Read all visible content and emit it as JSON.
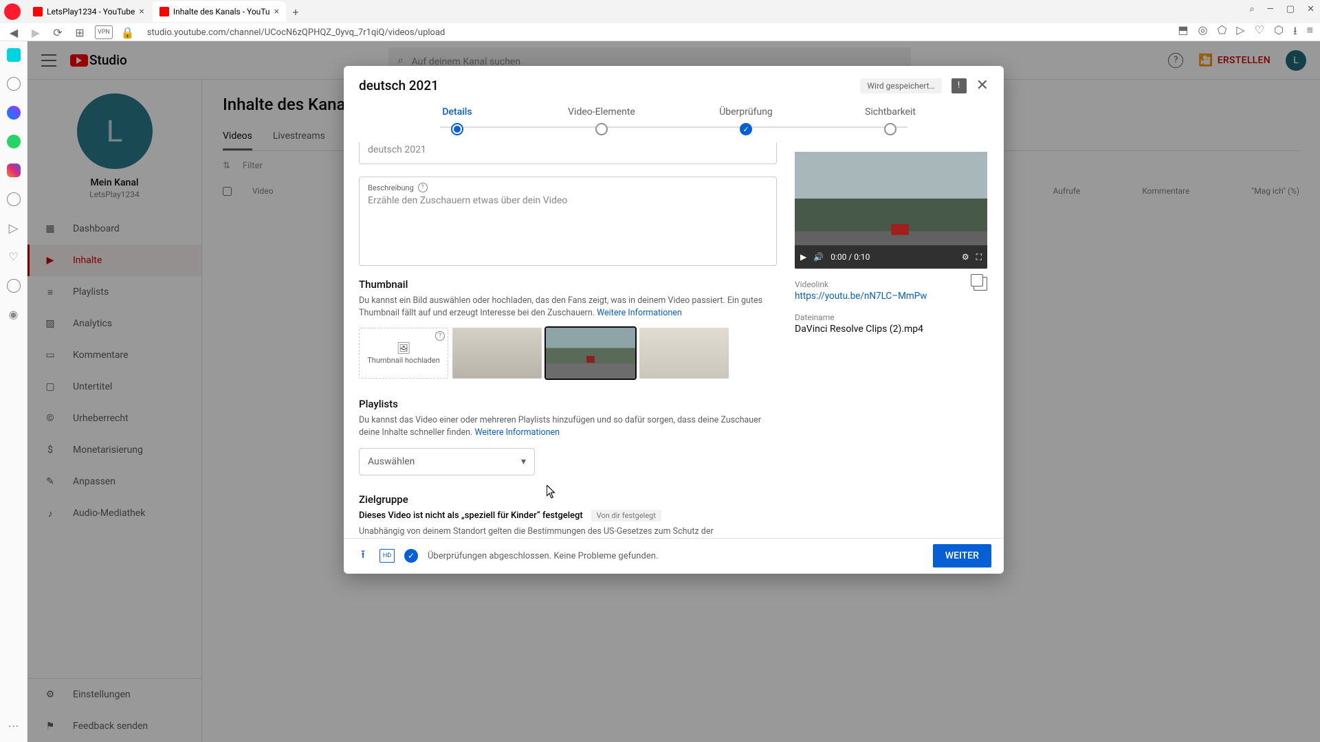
{
  "browser": {
    "tab1": "LetsPlay1234 - YouTube",
    "tab2": "Inhalte des Kanals - YouTu",
    "url": "studio.youtube.com/channel/UCocN6zQPHQZ_0yvq_7r1qiQ/videos/upload"
  },
  "header": {
    "logo_text": "Studio",
    "search_placeholder": "Auf deinem Kanal suchen",
    "create": "ERSTELLEN",
    "avatar": "L"
  },
  "channel": {
    "avatar_letter": "L",
    "name": "Mein Kanal",
    "handle": "LetsPlay1234"
  },
  "sidebar": {
    "dashboard": "Dashboard",
    "content": "Inhalte",
    "playlists": "Playlists",
    "analytics": "Analytics",
    "comments": "Kommentare",
    "subtitles": "Untertitel",
    "copyright": "Urheberrecht",
    "monetization": "Monetarisierung",
    "customize": "Anpassen",
    "audio": "Audio-Mediathek",
    "settings": "Einstellungen",
    "feedback": "Feedback senden"
  },
  "page": {
    "title": "Inhalte des Kanals",
    "tab_videos": "Videos",
    "tab_live": "Livestreams",
    "filter": "Filter",
    "col_video": "Video",
    "col_views": "Aufrufe",
    "col_comments": "Kommentare",
    "col_likes": "\"Mag ich\" (%)"
  },
  "dialog": {
    "title": "deutsch 2021",
    "saving": "Wird gespeichert…",
    "step1": "Details",
    "step2": "Video-Elemente",
    "step3": "Überprüfung",
    "step4": "Sichtbarkeit",
    "title_field_value": "deutsch 2021",
    "desc_label": "Beschreibung",
    "desc_placeholder": "Erzähle den Zuschauern etwas über dein Video",
    "thumb_title": "Thumbnail",
    "thumb_desc": "Du kannst ein Bild auswählen oder hochladen, das den Fans zeigt, was in deinem Video passiert. Ein gutes Thumbnail fällt auf und erzeugt Interesse bei den Zuschauern. ",
    "more_info": "Weitere Informationen",
    "thumb_upload": "Thumbnail hochladen",
    "playlists_title": "Playlists",
    "playlists_desc": "Du kannst das Video einer oder mehreren Playlists hinzufügen und so dafür sorgen, dass deine Zuschauer deine Inhalte schneller finden. ",
    "select_placeholder": "Auswählen",
    "target_title": "Zielgruppe",
    "target_bold": "Dieses Video ist nicht als „speziell für Kinder“ festgelegt",
    "target_badge": "Von dir festgelegt",
    "target_sub": "Unabhängig von deinem Standort gelten die Bestimmungen des US-Gesetzes zum Schutz der",
    "video_time": "0:00 / 0:10",
    "videolink_label": "Videolink",
    "videolink": "https://youtu.be/nN7LC–MmPw",
    "filename_label": "Dateiname",
    "filename": "DaVinci Resolve Clips (2).mp4",
    "footer_text": "Überprüfungen abgeschlossen. Keine Probleme gefunden.",
    "next": "WEITER"
  }
}
